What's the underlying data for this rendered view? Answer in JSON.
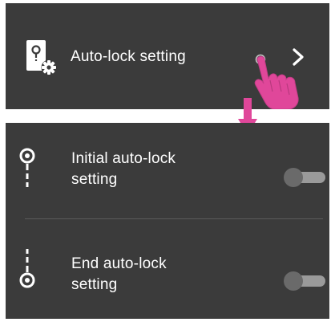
{
  "auto_lock_entry": {
    "label": "Auto-lock setting",
    "icon": "lock-gear-icon",
    "chevron": "chevron-right-icon",
    "gesture": "tap-hand-icon"
  },
  "transition": {
    "icon": "arrow-down-icon",
    "color": "#e0479a"
  },
  "settings": {
    "initial": {
      "label_line1": "Initial auto-lock",
      "label_line2": "setting",
      "icon": "initial-lock-icon",
      "toggle_on": false
    },
    "end": {
      "label_line1": "End auto-lock",
      "label_line2": "setting",
      "icon": "end-lock-icon",
      "toggle_on": false
    }
  },
  "colors": {
    "panel_background": "#3b3b3b",
    "text": "#ffffff",
    "toggle_track": "#9a9a9a",
    "toggle_knob": "#6a6a6a",
    "accent": "#e0479a"
  }
}
